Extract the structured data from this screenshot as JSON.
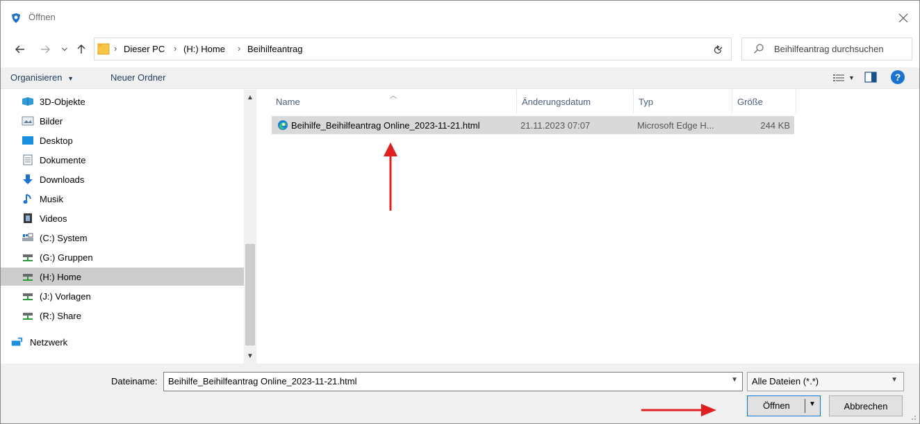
{
  "window": {
    "title": "Öffnen",
    "close_symbol": "✕"
  },
  "address": {
    "crumbs": [
      "Dieser PC",
      "(H:) Home",
      "Beihilfeantrag"
    ]
  },
  "search": {
    "placeholder": "Beihilfeantrag durchsuchen"
  },
  "toolbar": {
    "organize": "Organisieren",
    "new_folder": "Neuer Ordner"
  },
  "navigation": {
    "items": [
      {
        "label": "3D-Objekte",
        "icon": "3d-objects-icon"
      },
      {
        "label": "Bilder",
        "icon": "pictures-icon"
      },
      {
        "label": "Desktop",
        "icon": "desktop-icon"
      },
      {
        "label": "Dokumente",
        "icon": "documents-icon"
      },
      {
        "label": "Downloads",
        "icon": "downloads-icon"
      },
      {
        "label": "Musik",
        "icon": "music-icon"
      },
      {
        "label": "Videos",
        "icon": "videos-icon"
      },
      {
        "label": "(C:) System",
        "icon": "system-drive-icon"
      },
      {
        "label": "(G:) Gruppen",
        "icon": "network-drive-icon"
      },
      {
        "label": "(H:) Home",
        "icon": "network-drive-icon",
        "selected": true
      },
      {
        "label": "(J:) Vorlagen",
        "icon": "network-drive-icon"
      },
      {
        "label": "(R:) Share",
        "icon": "network-drive-icon"
      },
      {
        "label": "Netzwerk",
        "icon": "network-icon"
      }
    ]
  },
  "filelist": {
    "columns": [
      "Name",
      "Änderungsdatum",
      "Typ",
      "Größe"
    ],
    "rows": [
      {
        "name": "Beihilfe_Beihilfeantrag Online_2023-11-21.html",
        "date": "21.11.2023 07:07",
        "type": "Microsoft Edge H...",
        "size": "244 KB",
        "icon": "edge-icon"
      }
    ]
  },
  "bottom": {
    "filename_label": "Dateiname:",
    "filename_value": "Beihilfe_Beihilfeantrag Online_2023-11-21.html",
    "filter_value": "Alle Dateien (*.*)",
    "open_label": "Öffnen",
    "cancel_label": "Abbrechen"
  },
  "colors": {
    "accent": "#0078d7",
    "annotation_arrow": "#e02020",
    "selected_row": "#d9d9d9"
  }
}
